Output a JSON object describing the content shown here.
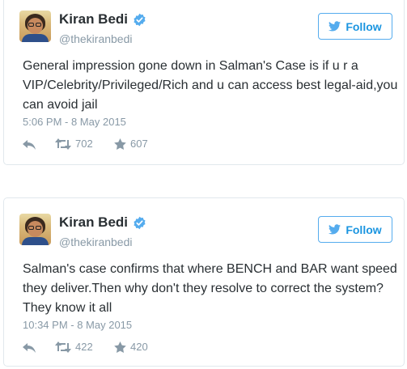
{
  "tweets": [
    {
      "name": "Kiran Bedi",
      "handle": "@thekiranbedi",
      "follow_label": "Follow",
      "text": "General impression gone down in Salman's Case is if u r a VIP/Celebrity/Privileged/Rich and u can access best legal-aid,you can avoid jail",
      "timestamp": "5:06 PM - 8 May 2015",
      "retweets": "702",
      "favorites": "607"
    },
    {
      "name": "Kiran Bedi",
      "handle": "@thekiranbedi",
      "follow_label": "Follow",
      "text": "Salman's case confirms that where  BENCH and BAR want speed they  deliver.Then why don't they resolve to correct the system?They know it all",
      "timestamp": "10:34 PM - 8 May 2015",
      "retweets": "422",
      "favorites": "420"
    }
  ],
  "colors": {
    "brand_blue": "#55acee",
    "follow_text": "#1b95e0",
    "muted": "#8899a6",
    "text": "#292f33",
    "border": "#e1e8ed"
  },
  "icons": [
    "verified-badge-icon",
    "twitter-bird-icon",
    "reply-icon",
    "retweet-icon",
    "favorite-star-icon"
  ]
}
